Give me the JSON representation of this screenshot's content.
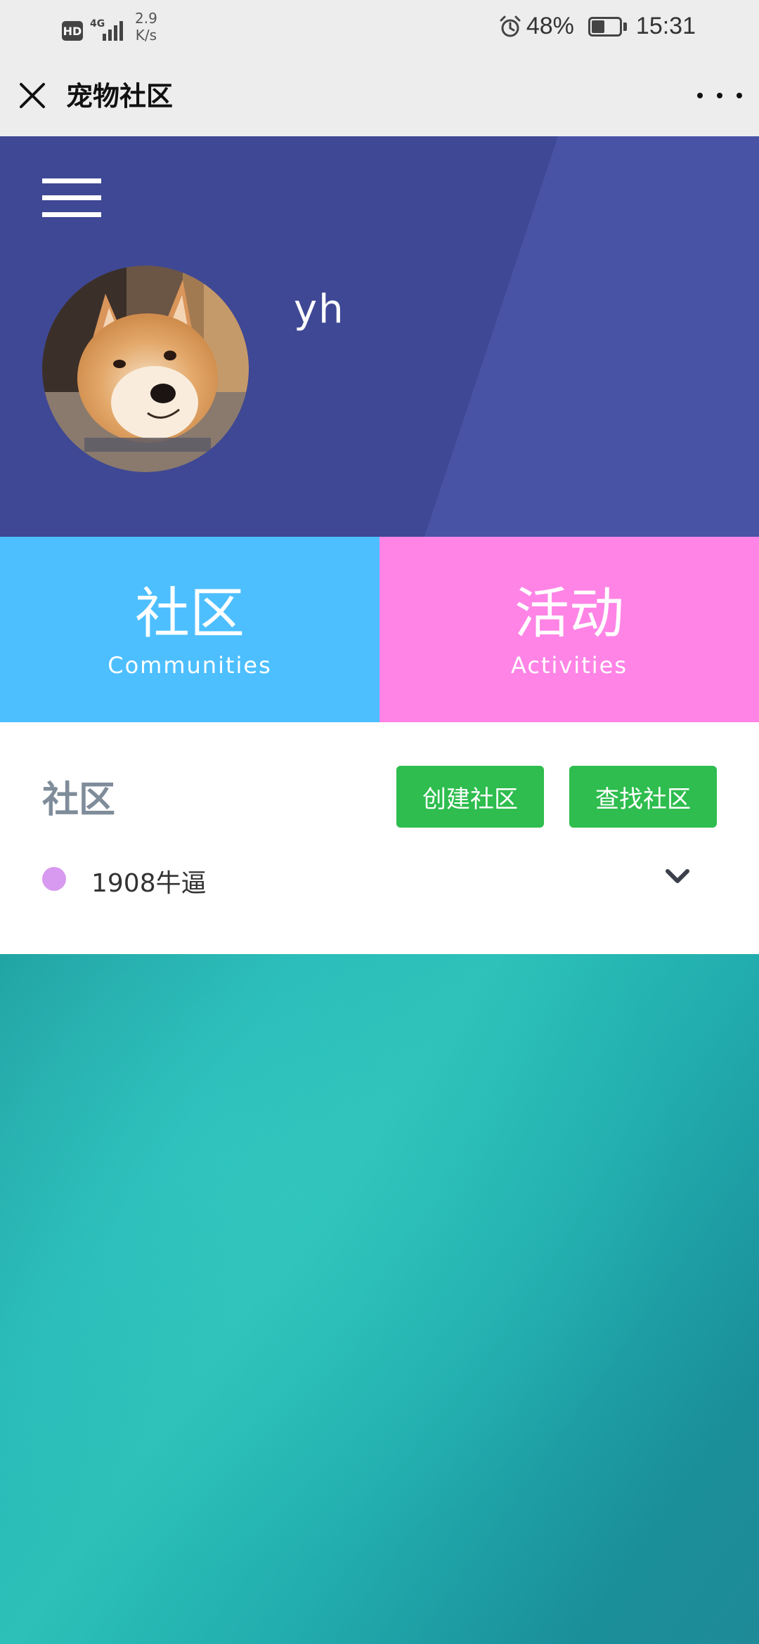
{
  "status_bar": {
    "hd": "HD",
    "network": "4G",
    "speed_value": "2.9",
    "speed_unit": "K/s",
    "battery_percent": "48%",
    "battery_level": 0.48,
    "time": "15:31"
  },
  "title_bar": {
    "title": "宠物社区"
  },
  "profile": {
    "username": "yh"
  },
  "tiles": {
    "communities": {
      "title": "社区",
      "subtitle": "Communities",
      "color": "#4dbfff"
    },
    "activities": {
      "title": "活动",
      "subtitle": "Activities",
      "color": "#ff84e6"
    }
  },
  "community_section": {
    "title": "社区",
    "create_button": "创建社区",
    "find_button": "查找社区",
    "items": [
      {
        "name": "1908牛逼",
        "dot_color": "#d89af0"
      }
    ]
  },
  "colors": {
    "header_bg": "#3f4895",
    "button_green": "#2ebd4e",
    "teal": "#26b3b2"
  },
  "icons": {
    "close": "close-icon",
    "more": "more-icon",
    "menu": "hamburger-menu-icon",
    "chevron": "chevron-down-icon",
    "alarm": "alarm-icon",
    "battery": "battery-icon",
    "signal": "signal-icon"
  }
}
